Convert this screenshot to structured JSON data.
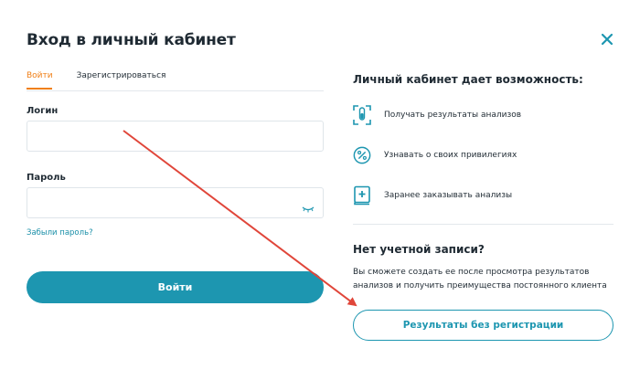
{
  "modal": {
    "title": "Вход в личный кабинет",
    "close_icon": "close-icon"
  },
  "tabs": [
    {
      "label": "Войти",
      "active": true
    },
    {
      "label": "Зарегистрироваться",
      "active": false
    }
  ],
  "form": {
    "login_label": "Логин",
    "login_value": "",
    "password_label": "Пароль",
    "password_value": "",
    "password_toggle_icon": "eye-closed-icon",
    "forgot_link": "Забыли пароль?",
    "submit_label": "Войти"
  },
  "benefits": {
    "title": "Личный кабинет дает возможность:",
    "items": [
      {
        "icon": "test-tube-icon",
        "text": "Получать результаты анализов"
      },
      {
        "icon": "percent-icon",
        "text": "Узнавать о своих привилегиях"
      },
      {
        "icon": "medical-book-icon",
        "text": "Заранее заказывать анализы"
      }
    ]
  },
  "no_account": {
    "title": "Нет учетной записи?",
    "description": "Вы сможете создать ее после просмотра результатов анализов и получить преимущества постоянного клиента",
    "button_label": "Результаты без регистрации"
  },
  "colors": {
    "accent_teal": "#1d96b0",
    "accent_orange": "#f07f16",
    "annotation_arrow": "#e0463a"
  }
}
